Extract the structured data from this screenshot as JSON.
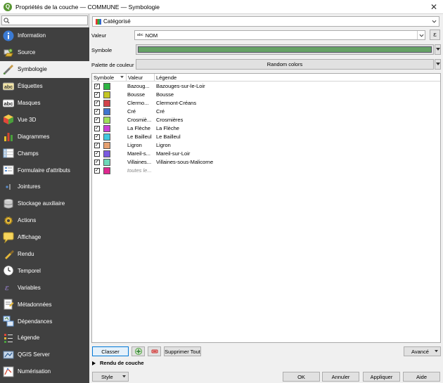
{
  "window": {
    "title": "Propriétés de la couche — COMMUNE — Symbologie",
    "close_glyph": "✕"
  },
  "search": {
    "placeholder": ""
  },
  "sidebar": {
    "items": [
      {
        "label": "Information",
        "icon": "info-icon"
      },
      {
        "label": "Source",
        "icon": "source-icon"
      },
      {
        "label": "Symbologie",
        "icon": "symbology-brush-icon",
        "active": true
      },
      {
        "label": "Étiquettes",
        "icon": "labels-abc-icon"
      },
      {
        "label": "Masques",
        "icon": "masks-abc-icon"
      },
      {
        "label": "Vue 3D",
        "icon": "3d-cube-icon"
      },
      {
        "label": "Diagrammes",
        "icon": "diagrams-icon"
      },
      {
        "label": "Champs",
        "icon": "fields-icon"
      },
      {
        "label": "Formulaire d'attributs",
        "icon": "attribute-form-icon"
      },
      {
        "label": "Jointures",
        "icon": "joins-icon"
      },
      {
        "label": "Stockage auxiliaire",
        "icon": "auxiliary-storage-icon"
      },
      {
        "label": "Actions",
        "icon": "actions-gear-icon"
      },
      {
        "label": "Affichage",
        "icon": "display-tooltip-icon"
      },
      {
        "label": "Rendu",
        "icon": "rendering-brush-icon"
      },
      {
        "label": "Temporel",
        "icon": "temporal-clock-icon"
      },
      {
        "label": "Variables",
        "icon": "variables-icon"
      },
      {
        "label": "Métadonnées",
        "icon": "metadata-icon"
      },
      {
        "label": "Dépendances",
        "icon": "dependencies-icon"
      },
      {
        "label": "Légende",
        "icon": "legend-icon"
      },
      {
        "label": "QGIS Server",
        "icon": "qgis-server-icon"
      },
      {
        "label": "Numérisation",
        "icon": "digitizing-icon"
      }
    ]
  },
  "renderer": {
    "selected": "Catégorisé"
  },
  "form": {
    "valeur_label": "Valeur",
    "valeur_type": "abc",
    "valeur_value": "NOM",
    "expression_glyph": "ε",
    "symbole_label": "Symbole",
    "symbole_color": "#66a266",
    "palette_label": "Palette de couleur",
    "palette_value": "Random colors"
  },
  "table": {
    "headers": {
      "symbole": "Symbole",
      "valeur": "Valeur",
      "legende": "Légende"
    },
    "rows": [
      {
        "valeur": "Bazouges-sur-le-Loir",
        "valeur_display": "Bazoug...",
        "legende": "Bazouges-sur-le-Loir",
        "color": "#2db542",
        "checked": true
      },
      {
        "valeur": "Bousse",
        "valeur_display": "Bousse",
        "legende": "Bousse",
        "color": "#c4c623",
        "checked": true
      },
      {
        "valeur": "Clermont-Créans",
        "valeur_display": "Clermo...",
        "legende": "Clermont-Créans",
        "color": "#d1424b",
        "checked": true
      },
      {
        "valeur": "Cré",
        "valeur_display": "Cré",
        "legende": "Cré",
        "color": "#3f74cf",
        "checked": true
      },
      {
        "valeur": "Crosmières",
        "valeur_display": "Crosmiè...",
        "legende": "Crosmières",
        "color": "#9ee05a",
        "checked": true
      },
      {
        "valeur": "La Flèche",
        "valeur_display": "La Flèche",
        "legende": "La Flèche",
        "color": "#c83fd8",
        "checked": true
      },
      {
        "valeur": "Le Bailleul",
        "valeur_display": "Le Bailleul",
        "legende": "Le Bailleul",
        "color": "#40c8e0",
        "checked": true
      },
      {
        "valeur": "Ligron",
        "valeur_display": "Ligron",
        "legende": "Ligron",
        "color": "#e5a070",
        "checked": true
      },
      {
        "valeur": "Mareil-sur-Loir",
        "valeur_display": "Mareil-s...",
        "legende": "Mareil-sur-Loir",
        "color": "#7b5ae0",
        "checked": true
      },
      {
        "valeur": "Villaines-sous-Malicorne",
        "valeur_display": "Villaines...",
        "legende": "Villaines-sous-Malicorne",
        "color": "#6fd8b8",
        "checked": true
      },
      {
        "valeur": "toutes les autres valeurs",
        "valeur_display": "toutes le...",
        "legende": "",
        "color": "#e02890",
        "checked": true,
        "others": true
      }
    ]
  },
  "buttons": {
    "classer": "Classer",
    "supprimer_tout": "Supprimer Tout",
    "avance": "Avancé",
    "rendu": "Rendu de couche",
    "style": "Style",
    "ok": "OK",
    "annuler": "Annuler",
    "appliquer": "Appliquer",
    "aide": "Aide"
  }
}
